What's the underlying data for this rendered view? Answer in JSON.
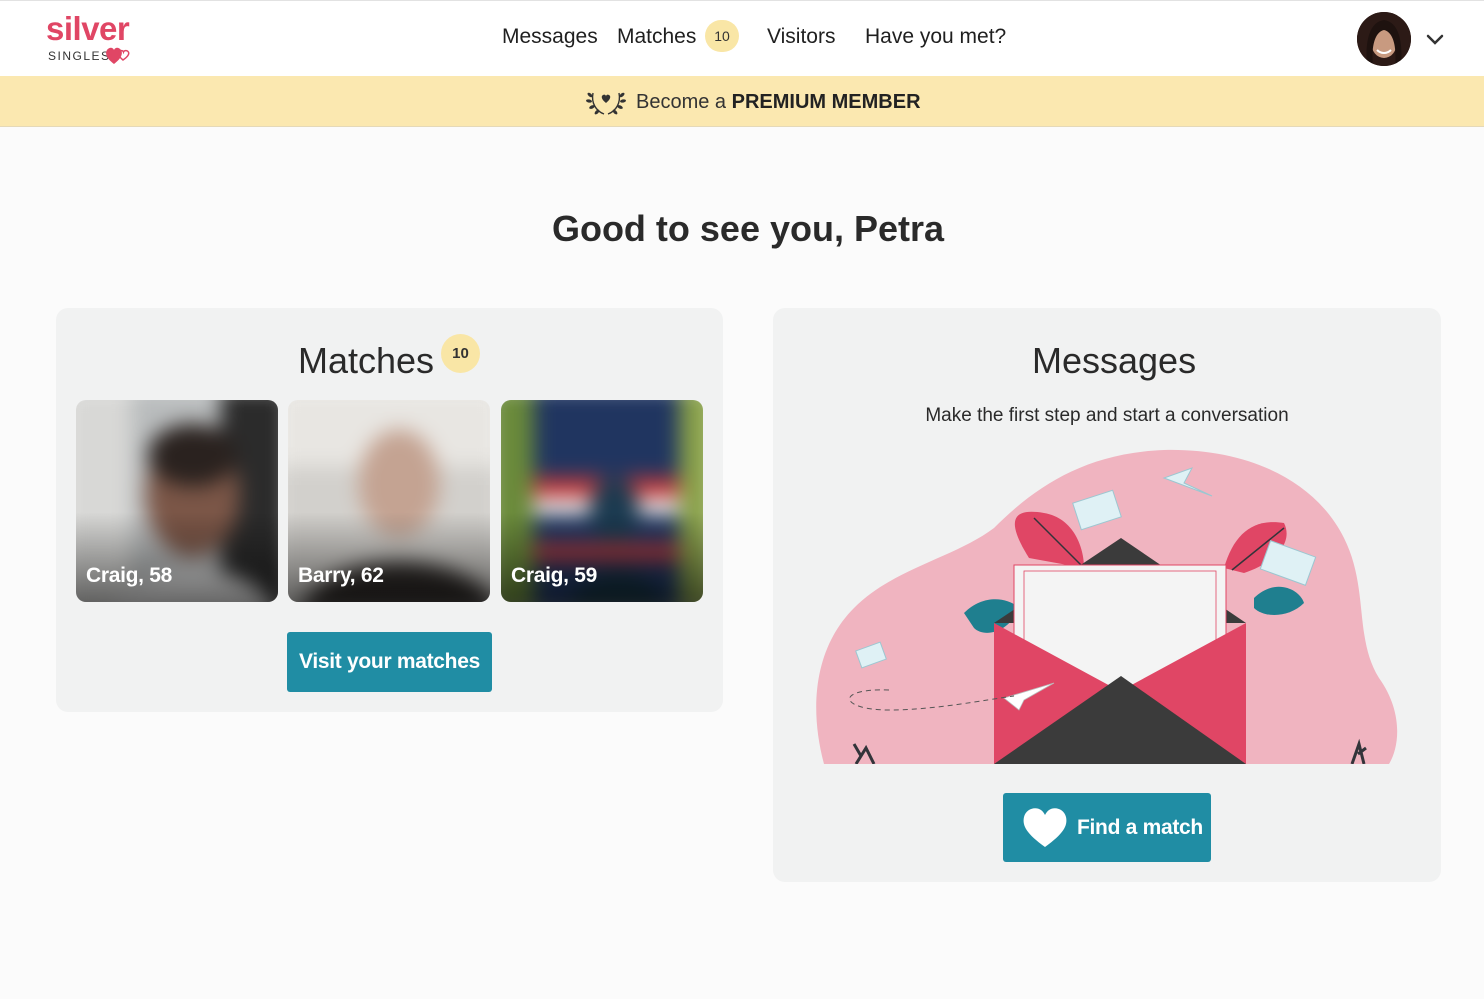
{
  "header": {
    "logo_word": "silver",
    "logo_sub": "SINGLES",
    "nav": [
      {
        "label": "Messages"
      },
      {
        "label": "Matches",
        "badge": "10"
      },
      {
        "label": "Visitors"
      },
      {
        "label": "Have you met?"
      }
    ],
    "icons": {
      "avatar": "user-avatar",
      "menu": "chevron-down-icon",
      "logo": "heart-logo-icon"
    }
  },
  "premium": {
    "prefix": "Become a",
    "emphasis": "PREMIUM MEMBER",
    "icon": "laurel-heart-icon"
  },
  "greeting": "Good to see you, Petra",
  "matches_card": {
    "title": "Matches",
    "badge": "10",
    "tiles": [
      {
        "label": "Craig, 58"
      },
      {
        "label": "Barry, 62"
      },
      {
        "label": "Craig, 59"
      }
    ],
    "button": "Visit your matches"
  },
  "messages_card": {
    "title": "Messages",
    "subtitle": "Make the first step and start a conversation",
    "illustration": "envelope-illustration",
    "button": "Find a match",
    "button_icon": "heart-icon"
  },
  "colors": {
    "brand": "#e04665",
    "accent": "#208da4",
    "premium_bg": "#fbe8b0",
    "badge_bg": "#f9e6a6",
    "card_bg": "#f1f2f2"
  }
}
